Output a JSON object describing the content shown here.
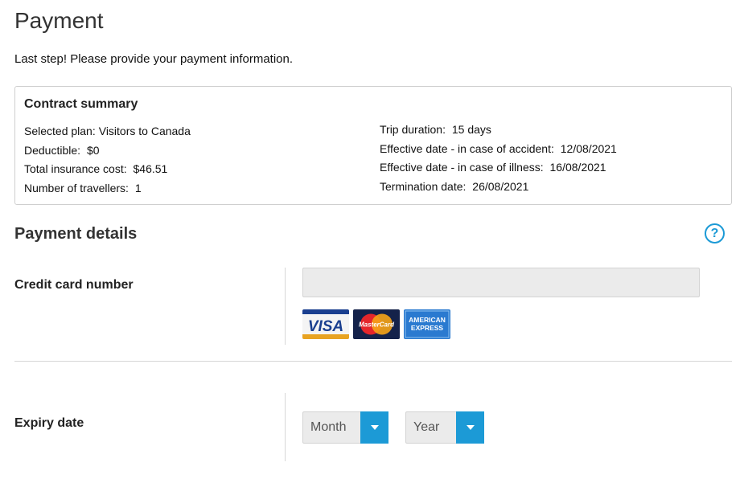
{
  "page": {
    "title": "Payment",
    "intro": "Last step! Please provide your payment information."
  },
  "summary": {
    "heading": "Contract summary",
    "left": [
      {
        "label": "Selected plan:",
        "value": "Visitors to Canada"
      },
      {
        "label": "Deductible:",
        "value": "$0"
      },
      {
        "label": "Total insurance cost:",
        "value": "$46.51"
      },
      {
        "label": "Number of travellers:",
        "value": "1"
      }
    ],
    "right": [
      {
        "label": "Trip duration:",
        "value": "15 days"
      },
      {
        "label": "Effective date - in case of accident:",
        "value": "12/08/2021"
      },
      {
        "label": "Effective date - in case of illness:",
        "value": "16/08/2021"
      },
      {
        "label": "Termination date:",
        "value": "26/08/2021"
      }
    ]
  },
  "payment_details": {
    "title": "Payment details",
    "help_icon": "?",
    "credit_card": {
      "label": "Credit card number",
      "value": "",
      "placeholder": "",
      "cards": [
        {
          "name": "visa-logo",
          "text": "VISA"
        },
        {
          "name": "mastercard-logo",
          "text": "MasterCard"
        },
        {
          "name": "amex-logo",
          "text": "AMERICAN EXPRESS"
        }
      ]
    },
    "expiry": {
      "label": "Expiry date",
      "month_selected": "Month",
      "year_selected": "Year"
    }
  },
  "colors": {
    "accent": "#1c9ad6",
    "input_bg": "#ebebeb",
    "border": "#cfcfcf"
  }
}
